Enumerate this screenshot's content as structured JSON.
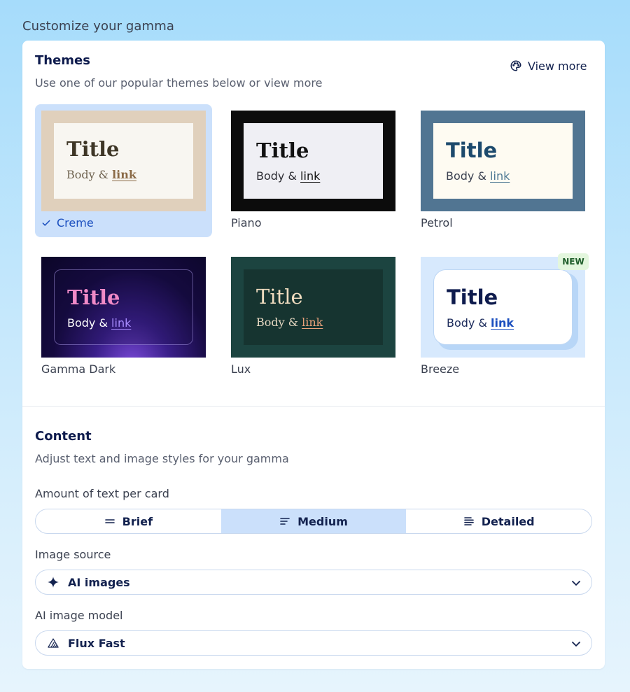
{
  "page_heading": "Customize your gamma",
  "themes": {
    "title": "Themes",
    "subtitle": "Use one of our popular themes below or view more",
    "view_more_label": "View more",
    "new_badge": "NEW",
    "items": [
      {
        "name": "Creme",
        "sample_title": "Title",
        "sample_body": "Body &",
        "sample_link": "link",
        "selected": true
      },
      {
        "name": "Piano",
        "sample_title": "Title",
        "sample_body": "Body &",
        "sample_link": "link"
      },
      {
        "name": "Petrol",
        "sample_title": "Title",
        "sample_body": "Body &",
        "sample_link": "link"
      },
      {
        "name": "Gamma Dark",
        "sample_title": "Title",
        "sample_body": "Body &",
        "sample_link": "link"
      },
      {
        "name": "Lux",
        "sample_title": "Title",
        "sample_body": "Body &",
        "sample_link": "link"
      },
      {
        "name": "Breeze",
        "sample_title": "Title",
        "sample_body": "Body &",
        "sample_link": "link"
      }
    ]
  },
  "content": {
    "title": "Content",
    "subtitle": "Adjust text and image styles for your gamma",
    "text_amount": {
      "label": "Amount of text per card",
      "options": [
        "Brief",
        "Medium",
        "Detailed"
      ],
      "selected": "Medium"
    },
    "image_source": {
      "label": "Image source",
      "value": "AI images",
      "icon": "sparkle-icon"
    },
    "image_model": {
      "label": "AI image model",
      "value": "Flux Fast",
      "icon": "flux-logo-icon"
    }
  },
  "colors": {
    "accent": "#1b4fbf",
    "selected_bg": "#cbe0fb",
    "new_badge_bg": "#e3f6dd"
  }
}
